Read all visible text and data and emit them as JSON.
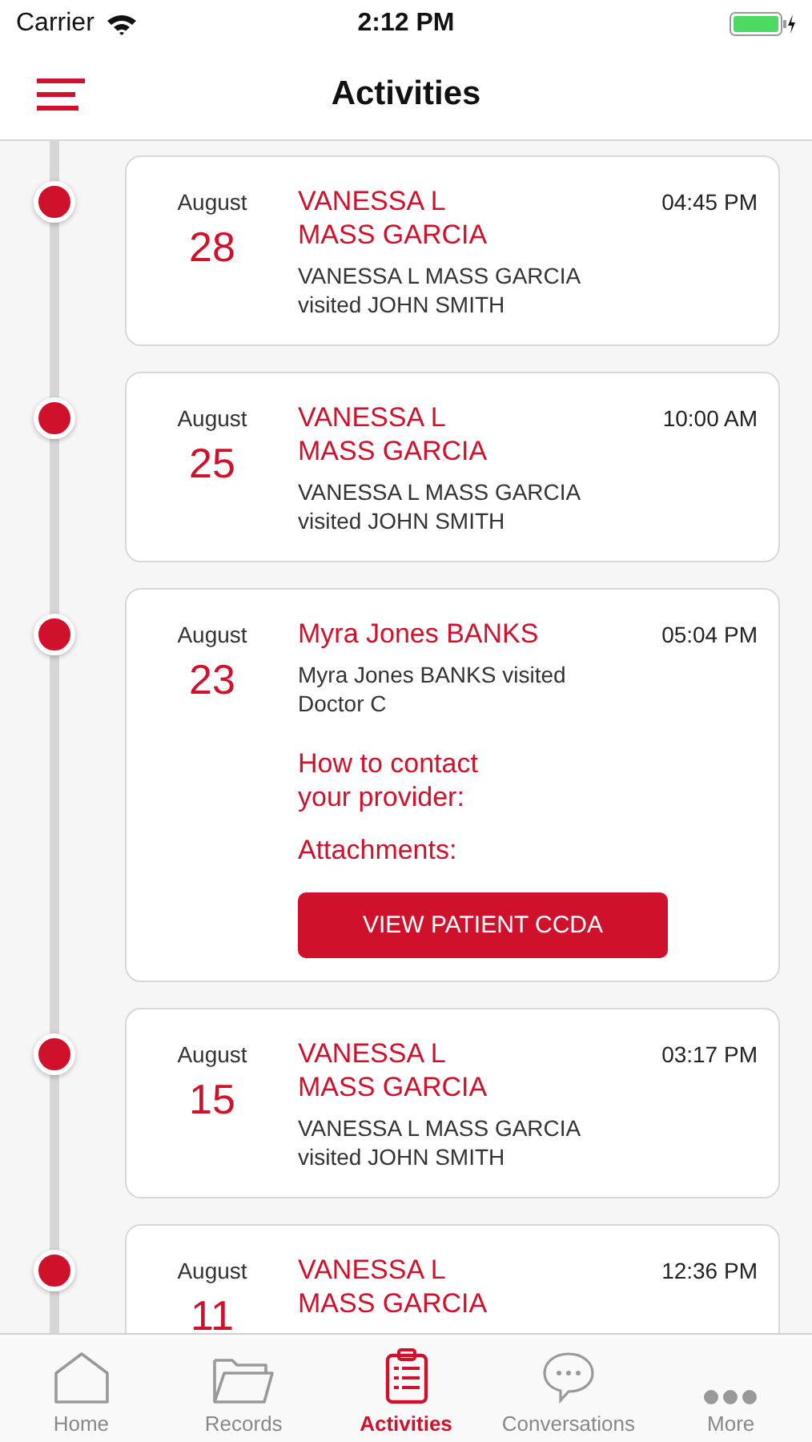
{
  "status_bar": {
    "carrier": "Carrier",
    "time": "2:12 PM"
  },
  "nav": {
    "title": "Activities"
  },
  "activities": [
    {
      "month": "August",
      "day": "28",
      "name": "VANESSA L\nMASS GARCIA",
      "time": "04:45 PM",
      "description": "VANESSA L MASS GARCIA\nvisited  JOHN SMITH"
    },
    {
      "month": "August",
      "day": "25",
      "name": "VANESSA L\nMASS GARCIA",
      "time": "10:00 AM",
      "description": "VANESSA L MASS GARCIA\nvisited  JOHN SMITH"
    },
    {
      "month": "August",
      "day": "23",
      "name": "Myra Jones BANKS",
      "time": "05:04 PM",
      "description": "Myra Jones BANKS visited\nDoctor C",
      "contact_label": "How to contact\nyour provider:",
      "attachments_label": "Attachments:",
      "action": "VIEW PATIENT CCDA"
    },
    {
      "month": "August",
      "day": "15",
      "name": "VANESSA L\nMASS GARCIA",
      "time": "03:17 PM",
      "description": "VANESSA L MASS GARCIA\nvisited  JOHN SMITH"
    },
    {
      "month": "August",
      "day": "11",
      "name": "VANESSA L\nMASS GARCIA",
      "time": "12:36 PM"
    }
  ],
  "tab_bar": [
    {
      "label": "Home",
      "selected": false
    },
    {
      "label": "Records",
      "selected": false
    },
    {
      "label": "Activities",
      "selected": true
    },
    {
      "label": "Conversations",
      "selected": false
    },
    {
      "label": "More",
      "selected": false
    }
  ]
}
